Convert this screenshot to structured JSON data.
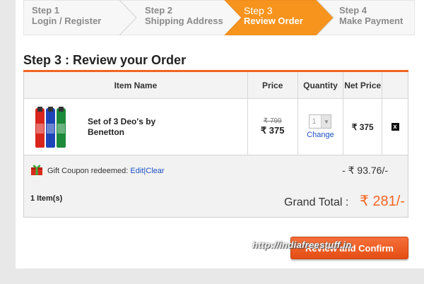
{
  "steps": [
    {
      "num": "Step 1",
      "title": "Login / Register"
    },
    {
      "num": "Step 2",
      "title": "Shipping Address"
    },
    {
      "num": "Step 3",
      "title": "Review Order"
    },
    {
      "num": "Step 4",
      "title": "Make Payment"
    }
  ],
  "page_title": "Step 3 : Review your Order",
  "table": {
    "headers": {
      "item": "Item Name",
      "price": "Price",
      "quantity": "Quantity",
      "net_price": "Net Price"
    },
    "items": [
      {
        "name": "Set of 3 Deo's by Benetton",
        "old_price": "₹ 799",
        "price": "₹ 375",
        "quantity": "1",
        "change_label": "Change",
        "net_price": "₹ 375",
        "remove_label": "x"
      }
    ]
  },
  "summary": {
    "coupon_text": "Gift Coupon redeemed:",
    "edit_label": "Edit",
    "separator": "|",
    "clear_label": "Clear",
    "discount": "- ₹ 93.76/-",
    "items_count": "1 Item(s)",
    "grand_total_label": "Grand Total :",
    "grand_total_value": "₹ 281/-"
  },
  "confirm_button": "Review and Confirm",
  "watermark": "http://indiafreestuff.in",
  "colors": {
    "accent": "#f26522",
    "link": "#1a4fc4"
  }
}
